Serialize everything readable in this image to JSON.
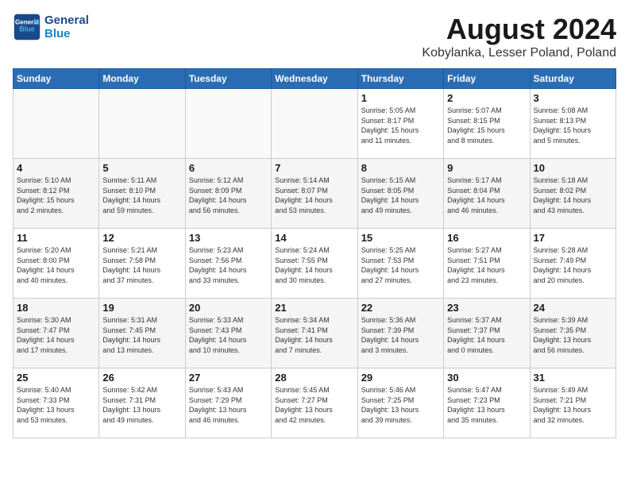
{
  "header": {
    "logo_line1": "General",
    "logo_line2": "Blue",
    "month_year": "August 2024",
    "location": "Kobylanka, Lesser Poland, Poland"
  },
  "weekdays": [
    "Sunday",
    "Monday",
    "Tuesday",
    "Wednesday",
    "Thursday",
    "Friday",
    "Saturday"
  ],
  "weeks": [
    [
      {
        "day": "",
        "info": ""
      },
      {
        "day": "",
        "info": ""
      },
      {
        "day": "",
        "info": ""
      },
      {
        "day": "",
        "info": ""
      },
      {
        "day": "1",
        "info": "Sunrise: 5:05 AM\nSunset: 8:17 PM\nDaylight: 15 hours\nand 11 minutes."
      },
      {
        "day": "2",
        "info": "Sunrise: 5:07 AM\nSunset: 8:15 PM\nDaylight: 15 hours\nand 8 minutes."
      },
      {
        "day": "3",
        "info": "Sunrise: 5:08 AM\nSunset: 8:13 PM\nDaylight: 15 hours\nand 5 minutes."
      }
    ],
    [
      {
        "day": "4",
        "info": "Sunrise: 5:10 AM\nSunset: 8:12 PM\nDaylight: 15 hours\nand 2 minutes."
      },
      {
        "day": "5",
        "info": "Sunrise: 5:11 AM\nSunset: 8:10 PM\nDaylight: 14 hours\nand 59 minutes."
      },
      {
        "day": "6",
        "info": "Sunrise: 5:12 AM\nSunset: 8:09 PM\nDaylight: 14 hours\nand 56 minutes."
      },
      {
        "day": "7",
        "info": "Sunrise: 5:14 AM\nSunset: 8:07 PM\nDaylight: 14 hours\nand 53 minutes."
      },
      {
        "day": "8",
        "info": "Sunrise: 5:15 AM\nSunset: 8:05 PM\nDaylight: 14 hours\nand 49 minutes."
      },
      {
        "day": "9",
        "info": "Sunrise: 5:17 AM\nSunset: 8:04 PM\nDaylight: 14 hours\nand 46 minutes."
      },
      {
        "day": "10",
        "info": "Sunrise: 5:18 AM\nSunset: 8:02 PM\nDaylight: 14 hours\nand 43 minutes."
      }
    ],
    [
      {
        "day": "11",
        "info": "Sunrise: 5:20 AM\nSunset: 8:00 PM\nDaylight: 14 hours\nand 40 minutes."
      },
      {
        "day": "12",
        "info": "Sunrise: 5:21 AM\nSunset: 7:58 PM\nDaylight: 14 hours\nand 37 minutes."
      },
      {
        "day": "13",
        "info": "Sunrise: 5:23 AM\nSunset: 7:56 PM\nDaylight: 14 hours\nand 33 minutes."
      },
      {
        "day": "14",
        "info": "Sunrise: 5:24 AM\nSunset: 7:55 PM\nDaylight: 14 hours\nand 30 minutes."
      },
      {
        "day": "15",
        "info": "Sunrise: 5:25 AM\nSunset: 7:53 PM\nDaylight: 14 hours\nand 27 minutes."
      },
      {
        "day": "16",
        "info": "Sunrise: 5:27 AM\nSunset: 7:51 PM\nDaylight: 14 hours\nand 23 minutes."
      },
      {
        "day": "17",
        "info": "Sunrise: 5:28 AM\nSunset: 7:49 PM\nDaylight: 14 hours\nand 20 minutes."
      }
    ],
    [
      {
        "day": "18",
        "info": "Sunrise: 5:30 AM\nSunset: 7:47 PM\nDaylight: 14 hours\nand 17 minutes."
      },
      {
        "day": "19",
        "info": "Sunrise: 5:31 AM\nSunset: 7:45 PM\nDaylight: 14 hours\nand 13 minutes."
      },
      {
        "day": "20",
        "info": "Sunrise: 5:33 AM\nSunset: 7:43 PM\nDaylight: 14 hours\nand 10 minutes."
      },
      {
        "day": "21",
        "info": "Sunrise: 5:34 AM\nSunset: 7:41 PM\nDaylight: 14 hours\nand 7 minutes."
      },
      {
        "day": "22",
        "info": "Sunrise: 5:36 AM\nSunset: 7:39 PM\nDaylight: 14 hours\nand 3 minutes."
      },
      {
        "day": "23",
        "info": "Sunrise: 5:37 AM\nSunset: 7:37 PM\nDaylight: 14 hours\nand 0 minutes."
      },
      {
        "day": "24",
        "info": "Sunrise: 5:39 AM\nSunset: 7:35 PM\nDaylight: 13 hours\nand 56 minutes."
      }
    ],
    [
      {
        "day": "25",
        "info": "Sunrise: 5:40 AM\nSunset: 7:33 PM\nDaylight: 13 hours\nand 53 minutes."
      },
      {
        "day": "26",
        "info": "Sunrise: 5:42 AM\nSunset: 7:31 PM\nDaylight: 13 hours\nand 49 minutes."
      },
      {
        "day": "27",
        "info": "Sunrise: 5:43 AM\nSunset: 7:29 PM\nDaylight: 13 hours\nand 46 minutes."
      },
      {
        "day": "28",
        "info": "Sunrise: 5:45 AM\nSunset: 7:27 PM\nDaylight: 13 hours\nand 42 minutes."
      },
      {
        "day": "29",
        "info": "Sunrise: 5:46 AM\nSunset: 7:25 PM\nDaylight: 13 hours\nand 39 minutes."
      },
      {
        "day": "30",
        "info": "Sunrise: 5:47 AM\nSunset: 7:23 PM\nDaylight: 13 hours\nand 35 minutes."
      },
      {
        "day": "31",
        "info": "Sunrise: 5:49 AM\nSunset: 7:21 PM\nDaylight: 13 hours\nand 32 minutes."
      }
    ]
  ]
}
